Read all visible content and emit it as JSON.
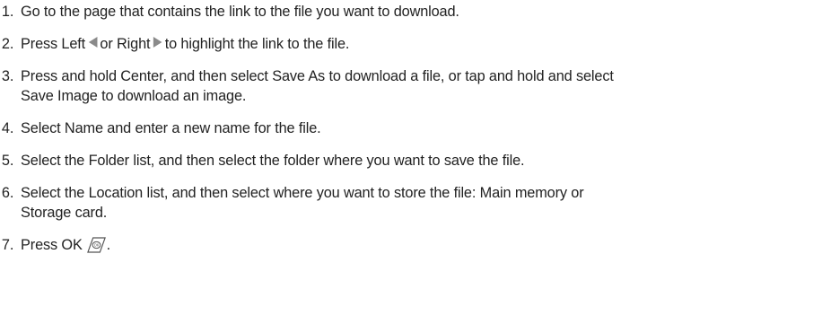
{
  "steps": [
    {
      "num": "1.",
      "text": "Go to the page that contains the link to the file you want to download."
    },
    {
      "num": "2.",
      "a": "Press Left",
      "b": "or Right",
      "c": "to highlight the link to the file.",
      "icon_left": "left-arrow-key-icon",
      "icon_right": "right-arrow-key-icon"
    },
    {
      "num": "3.",
      "line1": "Press and hold Center, and then select Save As to download a file, or tap and hold and select",
      "line2": "Save Image to download an image."
    },
    {
      "num": "4.",
      "text": "Select Name and enter a new name for the file."
    },
    {
      "num": "5.",
      "text": "Select the Folder list, and then select the folder where you want to save the file."
    },
    {
      "num": "6.",
      "line1": "Select the Location list, and then select where you want to store the file: Main memory or",
      "line2": "Storage card."
    },
    {
      "num": "7.",
      "a": "Press OK",
      "b": ".",
      "icon": "ok-key-icon"
    }
  ],
  "colors": {
    "text": "#222222",
    "icon": "#8a8a8a"
  }
}
